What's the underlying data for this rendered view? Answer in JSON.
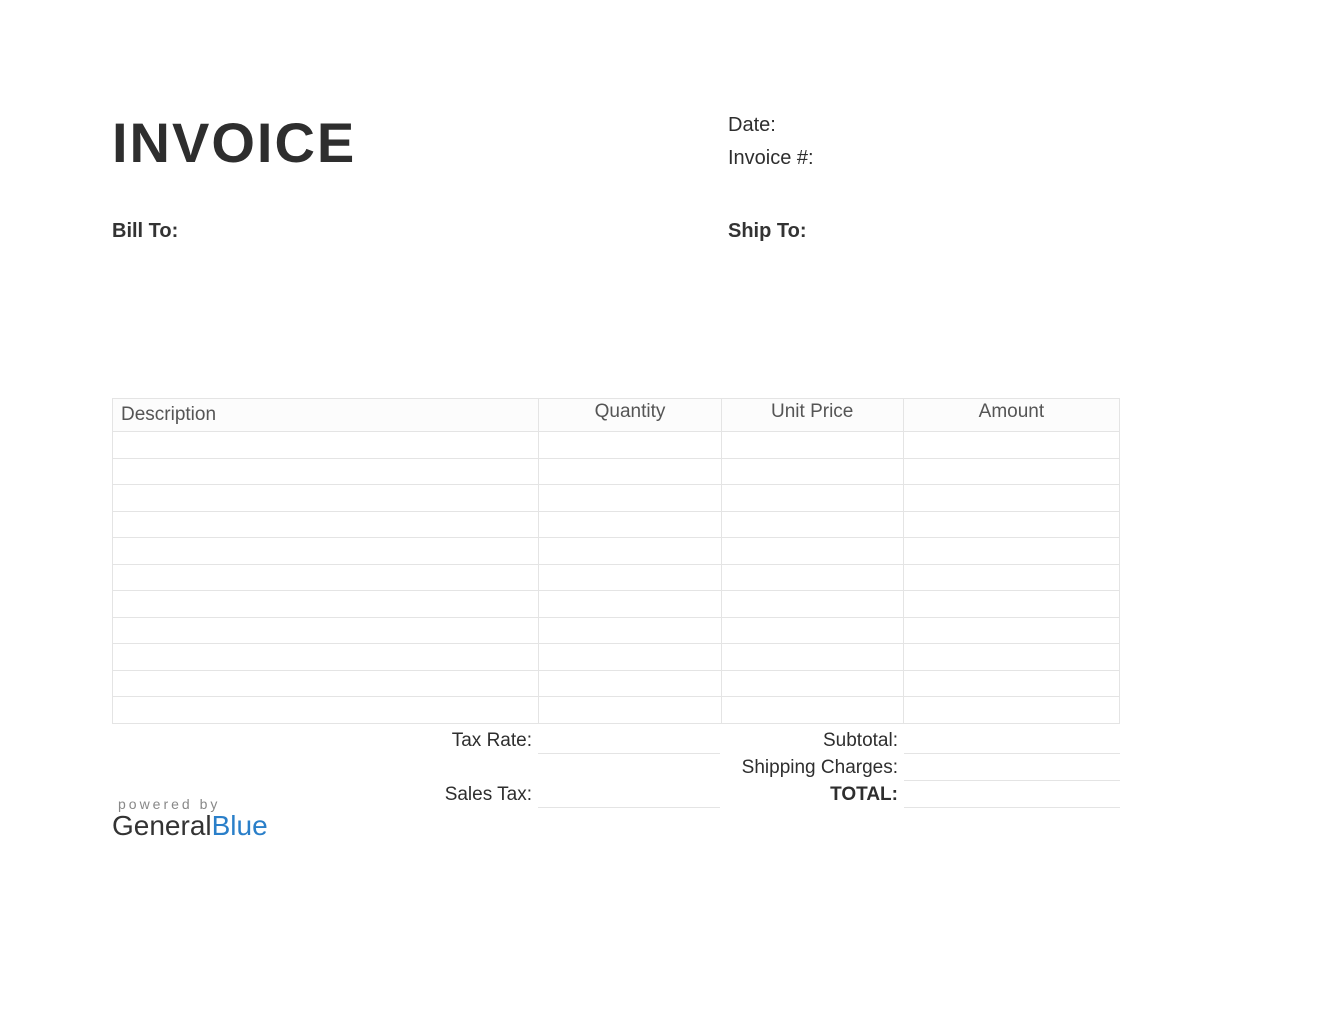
{
  "title": "INVOICE",
  "meta": {
    "date_label": "Date:",
    "invoice_label": "Invoice #:"
  },
  "addresses": {
    "bill_to_label": "Bill To:",
    "ship_to_label": "Ship To:"
  },
  "table": {
    "headers": {
      "description": "Description",
      "quantity": "Quantity",
      "unit_price": "Unit Price",
      "amount": "Amount"
    },
    "row_count": 11
  },
  "totals": {
    "tax_rate_label": "Tax Rate:",
    "sales_tax_label": "Sales Tax:",
    "subtotal_label": "Subtotal:",
    "shipping_label": "Shipping Charges:",
    "total_label": "TOTAL:"
  },
  "footer": {
    "powered_by": "powered by",
    "brand_first": "General",
    "brand_second": "Blue"
  }
}
